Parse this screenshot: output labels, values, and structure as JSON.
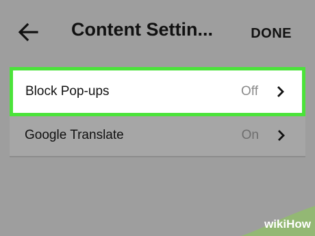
{
  "header": {
    "title": "Content Settin...",
    "done_label": "DONE",
    "back_icon": "arrow-left-icon"
  },
  "settings": [
    {
      "label": "Block Pop-ups",
      "value": "Off",
      "icon": "chevron-right-icon",
      "highlighted": true
    },
    {
      "label": "Google Translate",
      "value": "On",
      "icon": "chevron-right-icon",
      "highlighted": false
    }
  ],
  "watermark": {
    "text": "wikiHow"
  },
  "colors": {
    "background": "#9e9e9e",
    "highlight_border": "#4be33a",
    "watermark_green": "#93b874"
  }
}
